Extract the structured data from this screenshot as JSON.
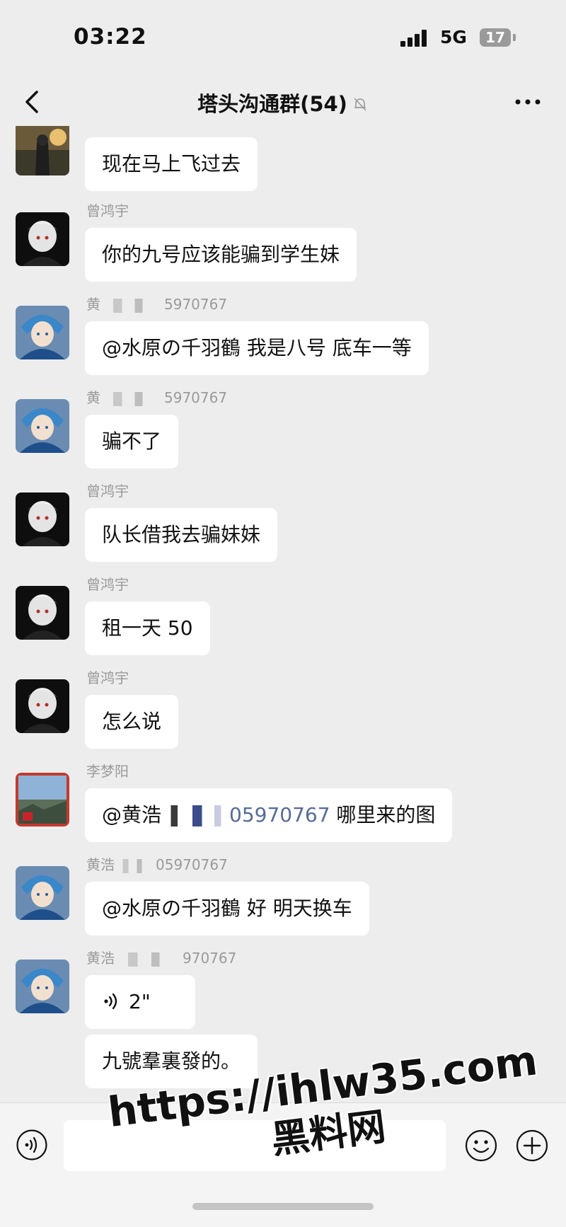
{
  "status_bar": {
    "time": "03:22",
    "network": "5G",
    "battery": "17"
  },
  "header": {
    "title": "塔头沟通群(54)",
    "back_icon": "chevron-left-icon",
    "mute_icon": "bell-off-icon",
    "more_icon": "more-dots-icon"
  },
  "messages": [
    {
      "sender": "",
      "text": "现在马上飞过去",
      "avatar": "outdoor-photo"
    },
    {
      "sender": "曾鸿宇",
      "text": "你的九号应该能骗到学生妹",
      "avatar": "anime-dark"
    },
    {
      "sender_prefix": "黄",
      "sender_suffix": "5970767",
      "text": "@水原の千羽鶴 我是八号 底车一等",
      "avatar": "anime-blue"
    },
    {
      "sender_prefix": "黄",
      "sender_suffix": "5970767",
      "text": "骗不了",
      "avatar": "anime-blue"
    },
    {
      "sender": "曾鸿宇",
      "text": "队长借我去骗妹妹",
      "avatar": "anime-dark"
    },
    {
      "sender": "曾鸿宇",
      "text": "租一天 50",
      "avatar": "anime-dark"
    },
    {
      "sender": "曾鸿宇",
      "text": "怎么说",
      "avatar": "anime-dark"
    },
    {
      "sender": "李梦阳",
      "text_prefix": "@黄浩",
      "text_link": "05970767",
      "text_suffix": " 哪里来的图",
      "avatar": "landscape-photo"
    },
    {
      "sender_prefix": "黄浩",
      "sender_suffix": "05970767",
      "text": "@水原の千羽鶴 好 明天换车",
      "avatar": "anime-blue"
    },
    {
      "sender_prefix": "黄浩",
      "sender_suffix": "970767",
      "voice_duration": "2\"",
      "text": "九號羣裏發的。",
      "avatar": "anime-blue"
    }
  ],
  "input_bar": {
    "voice_icon": "voice-icon",
    "emoji_icon": "emoji-icon",
    "plus_icon": "plus-circle-icon",
    "placeholder": ""
  },
  "watermark": {
    "url": "https://ihlw35.com",
    "brand": "黑料网"
  },
  "colors": {
    "background": "#ededed",
    "bubble": "#ffffff",
    "link": "#576b95",
    "sender": "#9a9a9a"
  }
}
